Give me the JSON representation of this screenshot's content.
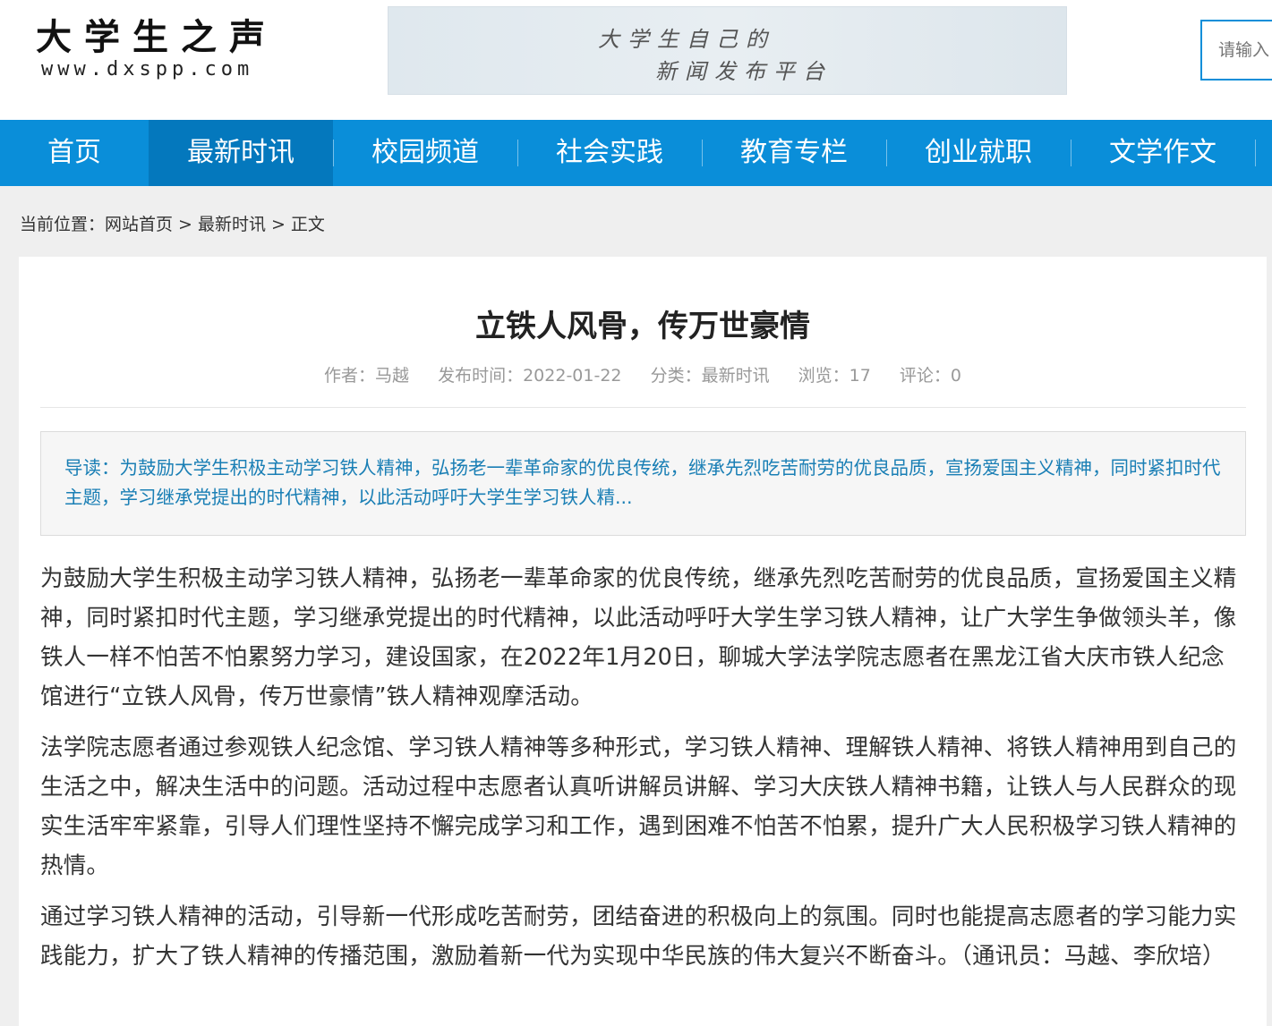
{
  "site": {
    "logo_name": "大学生之声",
    "logo_url": "www.dxspp.com",
    "banner_line1": "大学生自己的",
    "banner_line2": "新闻发布平台",
    "search_placeholder": "请输入"
  },
  "nav": {
    "items": [
      {
        "label": "首页"
      },
      {
        "label": "最新时讯"
      },
      {
        "label": "校园频道"
      },
      {
        "label": "社会实践"
      },
      {
        "label": "教育专栏"
      },
      {
        "label": "创业就职"
      },
      {
        "label": "文学作文"
      }
    ],
    "active_index": 1
  },
  "breadcrumb": {
    "prefix": "当前位置：",
    "home": "网站首页",
    "separator": ">",
    "category": "最新时讯",
    "current": "正文"
  },
  "article": {
    "title": "立铁人风骨，传万世豪情",
    "meta": {
      "author": "作者：马越",
      "published": "发布时间：2022-01-22",
      "category": "分类：最新时讯",
      "views": "浏览：17",
      "comments": "评论：0"
    },
    "summary": "导读：为鼓励大学生积极主动学习铁人精神，弘扬老一辈革命家的优良传统，继承先烈吃苦耐劳的优良品质，宣扬爱国主义精神，同时紧扣时代主题，学习继承党提出的时代精神，以此活动呼吁大学生学习铁人精...",
    "paragraphs": [
      "为鼓励大学生积极主动学习铁人精神，弘扬老一辈革命家的优良传统，继承先烈吃苦耐劳的优良品质，宣扬爱国主义精神，同时紧扣时代主题，学习继承党提出的时代精神，以此活动呼吁大学生学习铁人精神，让广大学生争做领头羊，像铁人一样不怕苦不怕累努力学习，建设国家，在2022年1月20日，聊城大学法学院志愿者在黑龙江省大庆市铁人纪念馆进行“立铁人风骨，传万世豪情”铁人精神观摩活动。",
      "法学院志愿者通过参观铁人纪念馆、学习铁人精神等多种形式，学习铁人精神、理解铁人精神、将铁人精神用到自己的生活之中，解决生活中的问题。活动过程中志愿者认真听讲解员讲解、学习大庆铁人精神书籍，让铁人与人民群众的现实生活牢牢紧靠，引导人们理性坚持不懈完成学习和工作，遇到困难不怕苦不怕累，提升广大人民积极学习铁人精神的热情。",
      "通过学习铁人精神的活动，引导新一代形成吃苦耐劳，团结奋进的积极向上的氛围。同时也能提高志愿者的学习能力实践能力，扩大了铁人精神的传播范围，激励着新一代为实现中华民族的伟大复兴不断奋斗。（通讯员：马越、李欣培）"
    ]
  },
  "colors": {
    "nav_bg": "#0a8ed9",
    "nav_active": "#0478bd",
    "summary_text": "#1a7fb5"
  }
}
